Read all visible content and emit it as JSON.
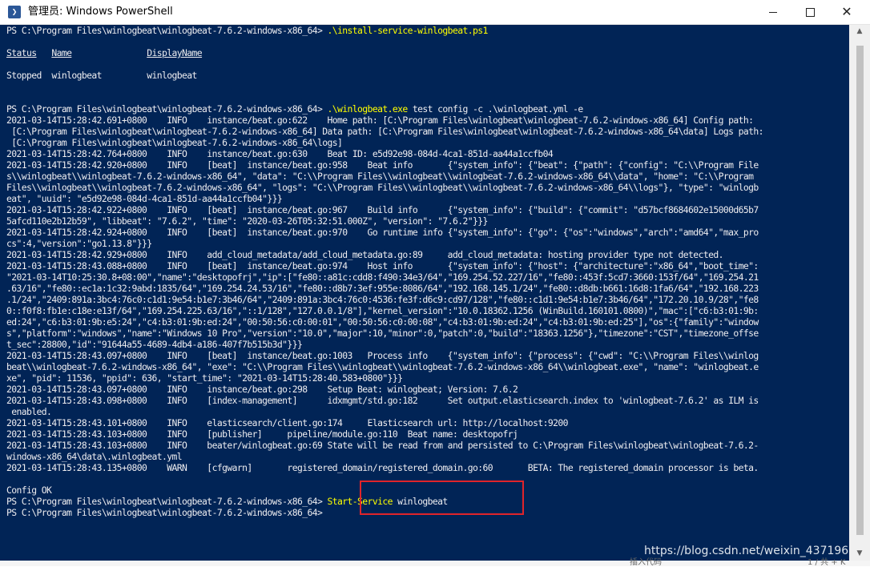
{
  "window": {
    "title": "管理员: Windows PowerShell",
    "app_icon_glyph": "❯",
    "minimize_icon": "minimize-icon",
    "maximize_icon": "maximize-icon",
    "close_icon": "close-icon",
    "close_glyph": "✕"
  },
  "colors": {
    "console_bg": "#012456",
    "console_text": "#eeedf0",
    "command_text": "#ffff00",
    "highlight_border": "#e0242a"
  },
  "console": {
    "lines": [
      [
        {
          "t": "PS C:\\Program Files\\winlogbeat\\winlogbeat-7.6.2-windows-x86_64> "
        },
        {
          "t": ".\\install-service-winlogbeat.ps1",
          "c": "cmd"
        }
      ],
      [
        {
          "t": ""
        }
      ],
      [
        {
          "t": "Status",
          "c": "u"
        },
        {
          "t": "   "
        },
        {
          "t": "Name",
          "c": "u"
        },
        {
          "t": "               "
        },
        {
          "t": "DisplayName",
          "c": "u"
        }
      ],
      [
        {
          "t": ""
        }
      ],
      [
        {
          "t": "Stopped  winlogbeat         winlogbeat"
        }
      ],
      [
        {
          "t": ""
        }
      ],
      [
        {
          "t": ""
        }
      ],
      [
        {
          "t": "PS C:\\Program Files\\winlogbeat\\winlogbeat-7.6.2-windows-x86_64> "
        },
        {
          "t": ".\\winlogbeat.exe",
          "c": "cmd"
        },
        {
          "t": " test config -c .\\winlogbeat.yml -e"
        }
      ],
      [
        {
          "t": "2021-03-14T15:28:42.691+0800    INFO    instance/beat.go:622    Home path: [C:\\Program Files\\winlogbeat\\winlogbeat-7.6.2-windows-x86_64] Config path:"
        }
      ],
      [
        {
          "t": " [C:\\Program Files\\winlogbeat\\winlogbeat-7.6.2-windows-x86_64] Data path: [C:\\Program Files\\winlogbeat\\winlogbeat-7.6.2-windows-x86_64\\data] Logs path:"
        }
      ],
      [
        {
          "t": " [C:\\Program Files\\winlogbeat\\winlogbeat-7.6.2-windows-x86_64\\logs]"
        }
      ],
      [
        {
          "t": "2021-03-14T15:28:42.764+0800    INFO    instance/beat.go:630    Beat ID: e5d92e98-084d-4ca1-851d-aa44a1ccfb04"
        }
      ],
      [
        {
          "t": "2021-03-14T15:28:42.920+0800    INFO    [beat]  instance/beat.go:958    Beat info       {\"system_info\": {\"beat\": {\"path\": {\"config\": \"C:\\\\Program File"
        }
      ],
      [
        {
          "t": "s\\\\winlogbeat\\\\winlogbeat-7.6.2-windows-x86_64\", \"data\": \"C:\\\\Program Files\\\\winlogbeat\\\\winlogbeat-7.6.2-windows-x86_64\\\\data\", \"home\": \"C:\\\\Program"
        }
      ],
      [
        {
          "t": "Files\\\\winlogbeat\\\\winlogbeat-7.6.2-windows-x86_64\", \"logs\": \"C:\\\\Program Files\\\\winlogbeat\\\\winlogbeat-7.6.2-windows-x86_64\\\\logs\"}, \"type\": \"winlogb"
        }
      ],
      [
        {
          "t": "eat\", \"uuid\": \"e5d92e98-084d-4ca1-851d-aa44a1ccfb04\"}}}"
        }
      ],
      [
        {
          "t": "2021-03-14T15:28:42.922+0800    INFO    [beat]  instance/beat.go:967    Build info      {\"system_info\": {\"build\": {\"commit\": \"d57bcf8684602e15000d65b7"
        }
      ],
      [
        {
          "t": "5afcd110e2b12b59\", \"libbeat\": \"7.6.2\", \"time\": \"2020-03-26T05:32:51.000Z\", \"version\": \"7.6.2\"}}}"
        }
      ],
      [
        {
          "t": "2021-03-14T15:28:42.924+0800    INFO    [beat]  instance/beat.go:970    Go runtime info {\"system_info\": {\"go\": {\"os\":\"windows\",\"arch\":\"amd64\",\"max_pro"
        }
      ],
      [
        {
          "t": "cs\":4,\"version\":\"go1.13.8\"}}}"
        }
      ],
      [
        {
          "t": "2021-03-14T15:28:42.929+0800    INFO    add_cloud_metadata/add_cloud_metadata.go:89     add_cloud_metadata: hosting provider type not detected."
        }
      ],
      [
        {
          "t": "2021-03-14T15:28:43.088+0800    INFO    [beat]  instance/beat.go:974    Host info       {\"system_info\": {\"host\": {\"architecture\":\"x86_64\",\"boot_time\":"
        }
      ],
      [
        {
          "t": "\"2021-03-14T10:25:30.8+08:00\",\"name\":\"desktopofrj\",\"ip\":[\"fe80::a81c:cdd8:f490:34e3/64\",\"169.254.52.227/16\",\"fe80::453f:5cd7:3660:153f/64\",\"169.254.21"
        }
      ],
      [
        {
          "t": ".63/16\",\"fe80::ec1a:1c32:9abd:1835/64\",\"169.254.24.53/16\",\"fe80::d8b7:3ef:955e:8086/64\",\"192.168.145.1/24\",\"fe80::d8db:b661:16d8:1fa6/64\",\"192.168.223"
        }
      ],
      [
        {
          "t": ".1/24\",\"2409:891a:3bc4:76c0:c1d1:9e54:b1e7:3b46/64\",\"2409:891a:3bc4:76c0:4536:fe3f:d6c9:cd97/128\",\"fe80::c1d1:9e54:b1e7:3b46/64\",\"172.20.10.9/28\",\"fe8"
        }
      ],
      [
        {
          "t": "0::f0f8:fb1e:c18e:e13f/64\",\"169.254.225.63/16\",\"::1/128\",\"127.0.0.1/8\"],\"kernel_version\":\"10.0.18362.1256 (WinBuild.160101.0800)\",\"mac\":[\"c6:b3:01:9b:"
        }
      ],
      [
        {
          "t": "ed:24\",\"c6:b3:01:9b:e5:24\",\"c4:b3:01:9b:ed:24\",\"00:50:56:c0:00:01\",\"00:50:56:c0:00:08\",\"c4:b3:01:9b:ed:24\",\"c4:b3:01:9b:ed:25\"],\"os\":{\"family\":\"window"
        }
      ],
      [
        {
          "t": "s\",\"platform\":\"windows\",\"name\":\"Windows 10 Pro\",\"version\":\"10.0\",\"major\":10,\"minor\":0,\"patch\":0,\"build\":\"18363.1256\"},\"timezone\":\"CST\",\"timezone_offse"
        }
      ],
      [
        {
          "t": "t_sec\":28800,\"id\":\"91644a55-4689-4db4-a186-407f7b515b3d\"}}}"
        }
      ],
      [
        {
          "t": "2021-03-14T15:28:43.097+0800    INFO    [beat]  instance/beat.go:1003   Process info    {\"system_info\": {\"process\": {\"cwd\": \"C:\\\\Program Files\\\\winlog"
        }
      ],
      [
        {
          "t": "beat\\\\winlogbeat-7.6.2-windows-x86_64\", \"exe\": \"C:\\\\Program Files\\\\winlogbeat\\\\winlogbeat-7.6.2-windows-x86_64\\\\winlogbeat.exe\", \"name\": \"winlogbeat.e"
        }
      ],
      [
        {
          "t": "xe\", \"pid\": 11536, \"ppid\": 636, \"start_time\": \"2021-03-14T15:28:40.583+0800\"}}}"
        }
      ],
      [
        {
          "t": "2021-03-14T15:28:43.097+0800    INFO    instance/beat.go:298    Setup Beat: winlogbeat; Version: 7.6.2"
        }
      ],
      [
        {
          "t": "2021-03-14T15:28:43.098+0800    INFO    [index-management]      idxmgmt/std.go:182      Set output.elasticsearch.index to 'winlogbeat-7.6.2' as ILM is"
        }
      ],
      [
        {
          "t": " enabled."
        }
      ],
      [
        {
          "t": "2021-03-14T15:28:43.101+0800    INFO    elasticsearch/client.go:174     Elasticsearch url: http://localhost:9200"
        }
      ],
      [
        {
          "t": "2021-03-14T15:28:43.103+0800    INFO    [publisher]     pipeline/module.go:110  Beat name: desktopofrj"
        }
      ],
      [
        {
          "t": "2021-03-14T15:28:43.103+0800    INFO    beater/winlogbeat.go:69 State will be read from and persisted to C:\\Program Files\\winlogbeat\\winlogbeat-7.6.2-"
        }
      ],
      [
        {
          "t": "windows-x86_64\\data\\.winlogbeat.yml"
        }
      ],
      [
        {
          "t": "2021-03-14T15:28:43.135+0800    WARN    [cfgwarn]       registered_domain/registered_domain.go:60       BETA: The registered_domain processor is beta."
        }
      ],
      [
        {
          "t": ""
        }
      ],
      [
        {
          "t": "Config OK"
        }
      ],
      [
        {
          "t": "PS C:\\Program Files\\winlogbeat\\winlogbeat-7.6.2-windows-x86_64> "
        },
        {
          "t": "Start-Service",
          "c": "cmd"
        },
        {
          "t": " winlogbeat"
        }
      ],
      [
        {
          "t": "PS C:\\Program Files\\winlogbeat\\winlogbeat-7.6.2-windows-x86_64>"
        }
      ]
    ]
  },
  "scrollbar": {
    "up_arrow": "▲",
    "down_arrow": "▼"
  },
  "background": {
    "bottom_left_text": "插入代码",
    "bottom_right_text": "1 / 共 + K"
  },
  "watermark": "https://blog.csdn.net/weixin_437196"
}
